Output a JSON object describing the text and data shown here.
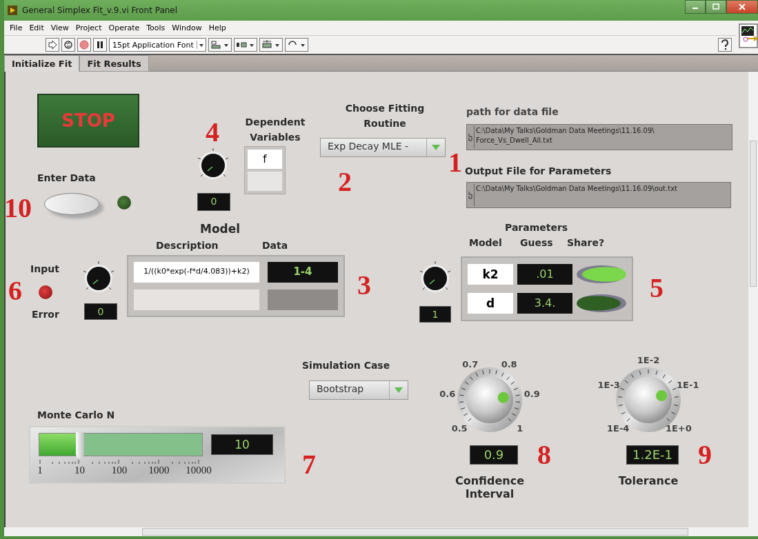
{
  "window": {
    "title": "General Simplex Fit_v.9.vi Front Panel"
  },
  "menu": [
    "File",
    "Edit",
    "View",
    "Project",
    "Operate",
    "Tools",
    "Window",
    "Help"
  ],
  "toolbar": {
    "font": "15pt Application Font"
  },
  "tabs": [
    {
      "label": "Initialize Fit",
      "selected": true
    },
    {
      "label": "Fit Results",
      "selected": false
    }
  ],
  "stop_button": {
    "label": "STOP"
  },
  "enter_data": {
    "label": "Enter Data",
    "switch_on": false,
    "led_on": false,
    "callout": "10"
  },
  "dependent_variables": {
    "label": "Dependent Variables",
    "index": "0",
    "values": [
      "f"
    ],
    "callout": "4"
  },
  "fitting_routine": {
    "label": "Choose Fitting Routine",
    "value": "Exp Decay MLE -",
    "callout": "2"
  },
  "data_path": {
    "label": "path for data file",
    "lines": [
      "C:\\Data\\My Talks\\Goldman Data Meetings\\11.16.09\\",
      "Force_Vs_Dwell_All.txt"
    ],
    "callout": "1"
  },
  "output_path": {
    "label": "Output File for Parameters",
    "value": "C:\\Data\\My Talks\\Goldman Data Meetings\\11.16.09\\out.txt"
  },
  "error_indicator": {
    "label_top": "Input",
    "label_bottom": "Error",
    "on": true,
    "callout": "6"
  },
  "model": {
    "title": "Model",
    "columns": [
      "Description",
      "Data"
    ],
    "index": "0",
    "rows": [
      {
        "description": "1/((k0*exp(-f*d/4.083))+k2)",
        "data": "1-4"
      }
    ],
    "callout": "3"
  },
  "parameters": {
    "title": "Parameters",
    "columns": [
      "Model",
      "Guess",
      "Share?"
    ],
    "index": "1",
    "rows": [
      {
        "model": "k2",
        "guess": ".01",
        "share": true
      },
      {
        "model": "d",
        "guess": "3.4.",
        "share": false
      }
    ],
    "callout": "5"
  },
  "simulation_case": {
    "label": "Simulation Case",
    "value": "Bootstrap"
  },
  "monte_carlo": {
    "label": "Monte Carlo N",
    "level": 0.25,
    "value": "10",
    "scale": [
      "1",
      "10",
      "100",
      "1000",
      "10000"
    ],
    "callout": "7"
  },
  "confidence": {
    "label": "Confidence Interval",
    "ticks": [
      "0.5",
      "0.6",
      "0.7",
      "0.8",
      "0.9",
      "1"
    ],
    "level": 0.8,
    "value": "0.9",
    "callout": "8"
  },
  "tolerance": {
    "label": "Tolerance",
    "ticks": [
      "1E-4",
      "1E-3",
      "1E-2",
      "1E-1",
      "1E+0"
    ],
    "level": 0.77,
    "value": "1.2E-1",
    "callout": "9"
  }
}
